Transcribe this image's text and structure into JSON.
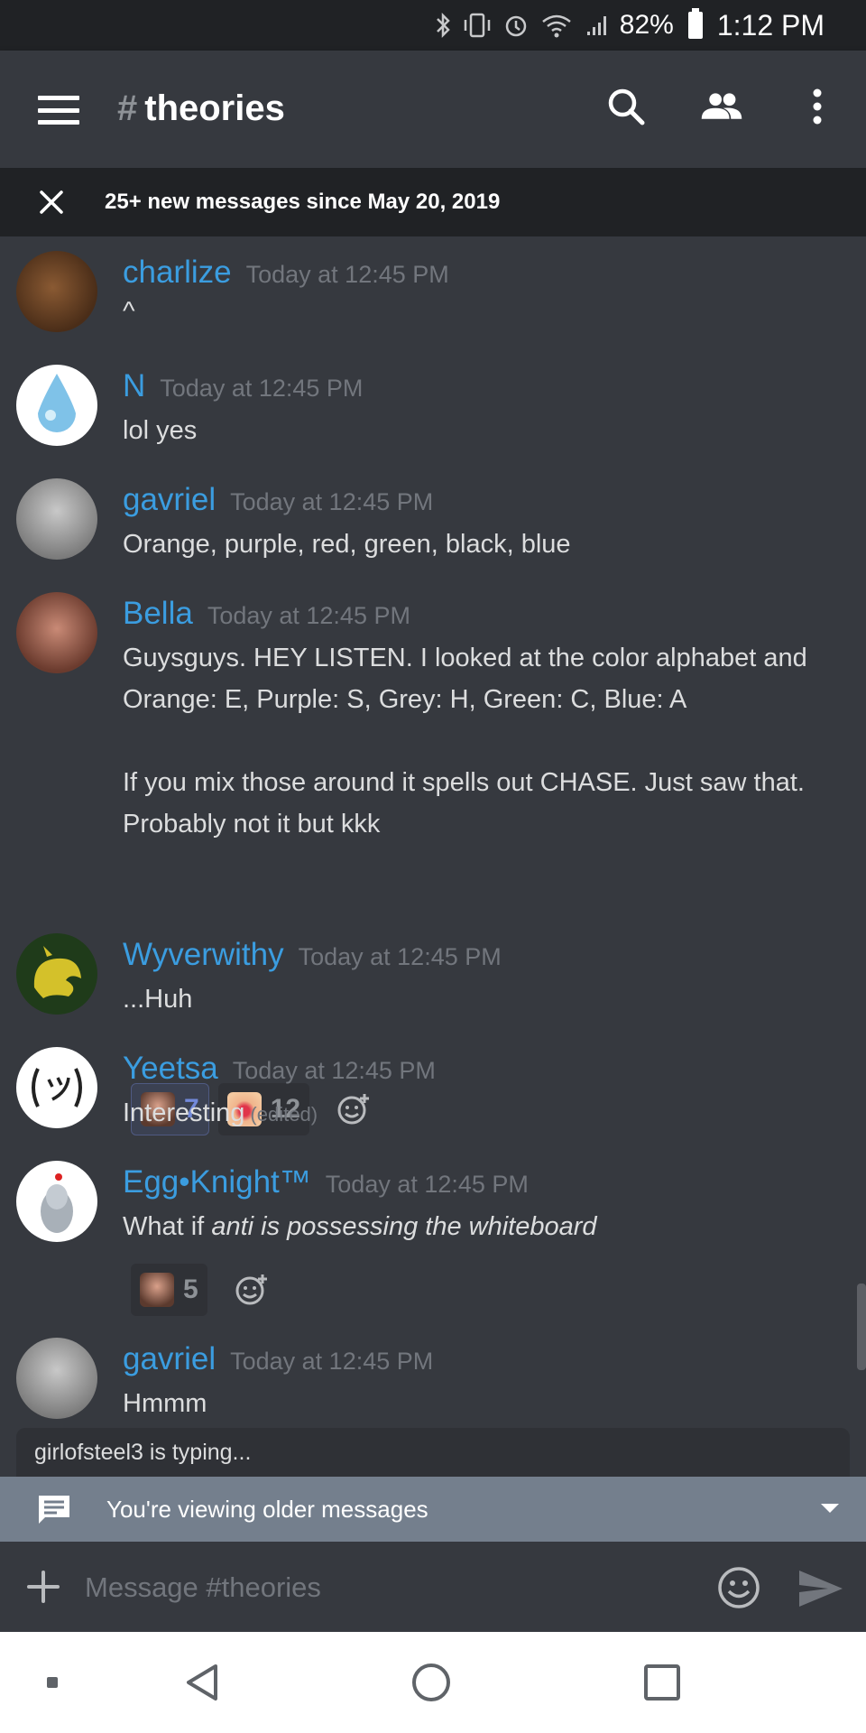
{
  "status_bar": {
    "battery": "82%",
    "time": "1:12 PM"
  },
  "header": {
    "hash": "#",
    "channel": "theories",
    "icons": [
      "menu-icon",
      "search-icon",
      "members-icon",
      "more-vert-icon"
    ]
  },
  "new_messages_banner": {
    "text": "25+ new messages since May 20, 2019"
  },
  "messages": [
    {
      "author": "charlize",
      "timestamp": "Today at 12:45 PM",
      "lines": [
        "^"
      ]
    },
    {
      "author": "N",
      "timestamp": "Today at 12:45 PM",
      "lines": [
        "lol yes"
      ]
    },
    {
      "author": "gavriel",
      "timestamp": "Today at 12:45 PM",
      "lines": [
        "Orange, purple, red, green, black, blue"
      ]
    },
    {
      "author": "Bella",
      "timestamp": "Today at 12:45 PM",
      "lines": [
        "Guysguys. HEY LISTEN. I looked at the color alphabet and",
        "Orange: E, Purple: S, Grey: H, Green: C, Blue: A",
        "If you mix those around it spells out CHASE. Just saw that.",
        "Probably not it but kkk"
      ],
      "reactions": [
        {
          "count": "7"
        },
        {
          "count": "12"
        }
      ]
    },
    {
      "author": "Wyverwithy",
      "timestamp": "Today at 12:45 PM",
      "lines": [
        "...Huh"
      ]
    },
    {
      "author": "Yeetsa",
      "timestamp": "Today at 12:45 PM",
      "lines": [
        "Interesting"
      ],
      "edited": "(edited)"
    },
    {
      "author": "Egg•Knight™",
      "timestamp": "Today at 12:45 PM",
      "prefix": "What if ",
      "italic": "anti is possessing the whiteboard",
      "reactions": [
        {
          "count": "5"
        }
      ]
    },
    {
      "author": "gavriel",
      "timestamp": "Today at 12:45 PM",
      "lines": [
        "Hmmm"
      ]
    }
  ],
  "typing_indicator": "girlofsteel3 is typing...",
  "older_bar": {
    "text": "You're viewing older messages"
  },
  "composer": {
    "placeholder": "Message #theories"
  },
  "colors": {
    "background": "#36393f",
    "username": "#3b9de0",
    "timestamp": "#72767d",
    "banner": "#202225",
    "older_bar": "#747f8d"
  }
}
